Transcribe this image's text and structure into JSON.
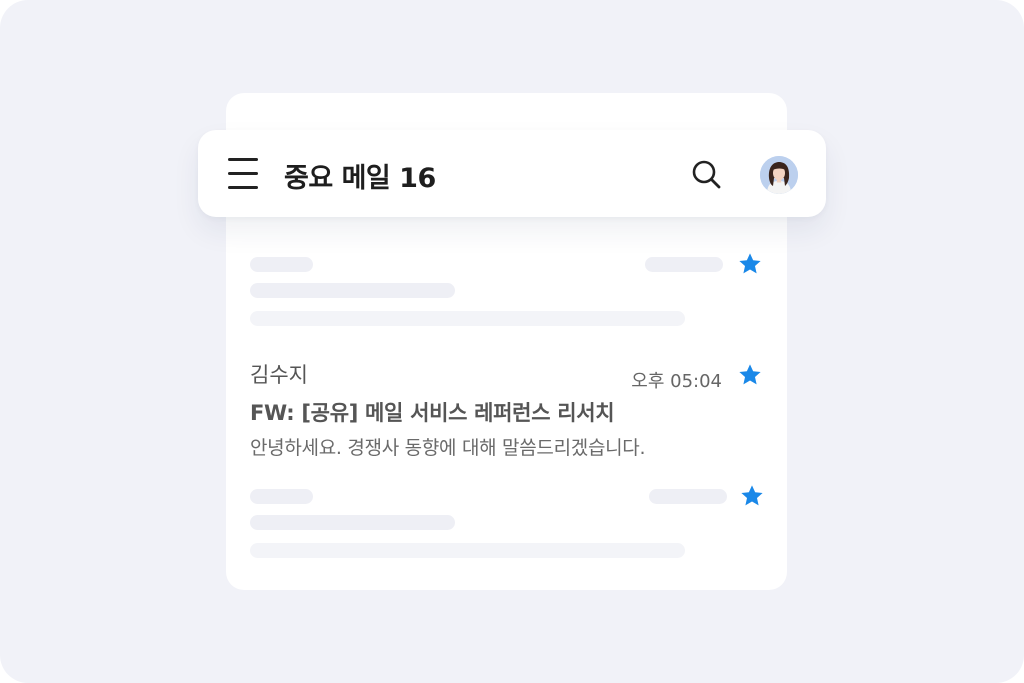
{
  "header": {
    "title": "중요 메일 16"
  },
  "mail": {
    "sender": "김수지",
    "time": "오후 05:04",
    "subject": "FW: [공유] 메일 서비스 레퍼런스 리서치",
    "preview": "안녕하세요. 경쟁사 동향에 대해 말씀드리겠습니다.",
    "starred": true
  },
  "icons": {
    "menu": "menu-icon",
    "search": "search-icon",
    "avatar": "avatar",
    "star": "star-icon"
  },
  "colors": {
    "background": "#f1f2f8",
    "card": "#ffffff",
    "star": "#1a88e8",
    "title": "#1e1e1e",
    "skeleton": "#eeeff5"
  }
}
